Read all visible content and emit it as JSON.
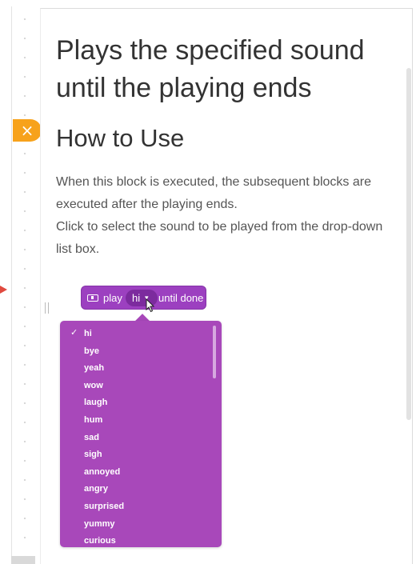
{
  "doc": {
    "title": "Plays the specified sound until the playing ends",
    "heading": "How to Use",
    "para1": "When this block is executed, the subsequent blocks are executed after the playing ends.",
    "para2": "Click to select the sound to be played from the drop-down list box."
  },
  "block": {
    "play_label": "play",
    "selected_sound": "hi",
    "dropdown_arrow": "▾",
    "until_label": "until done"
  },
  "dropdown": {
    "checkmark": "✓",
    "items": [
      "hi",
      "bye",
      "yeah",
      "wow",
      "laugh",
      "hum",
      "sad",
      "sigh",
      "annoyed",
      "angry",
      "surprised",
      "yummy",
      "curious"
    ]
  },
  "ui": {
    "close_glyph": "×",
    "icons": [
      "close-icon",
      "sound-icon",
      "chevron-down-icon",
      "checkmark-icon",
      "cursor-icon"
    ]
  },
  "colors": {
    "accent": "#f7a21b",
    "block": "#9c40c0",
    "block_pill": "#7c2b9e",
    "dropdown": "#a848ba",
    "arrow": "#e04a3f"
  }
}
